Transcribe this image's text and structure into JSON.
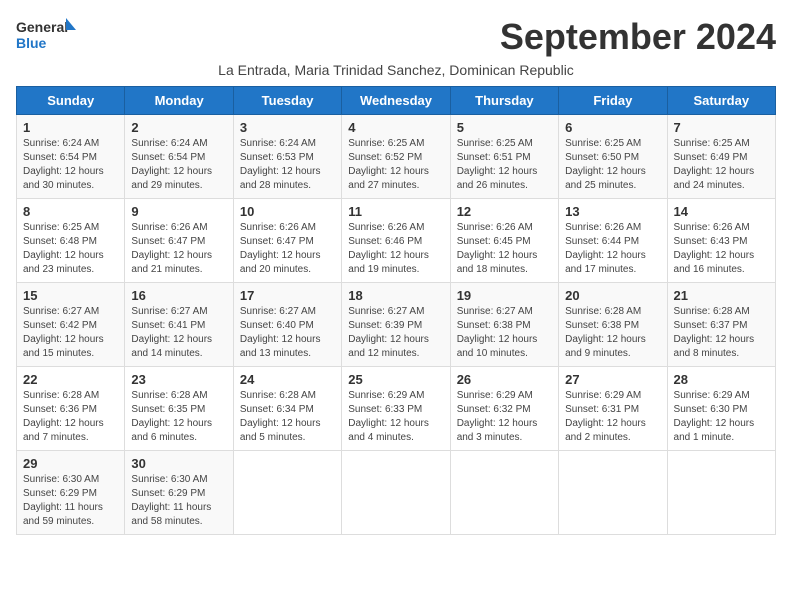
{
  "logo": {
    "line1": "General",
    "line2": "Blue"
  },
  "title": "September 2024",
  "subtitle": "La Entrada, Maria Trinidad Sanchez, Dominican Republic",
  "weekdays": [
    "Sunday",
    "Monday",
    "Tuesday",
    "Wednesday",
    "Thursday",
    "Friday",
    "Saturday"
  ],
  "weeks": [
    [
      {
        "day": "1",
        "rise": "6:24 AM",
        "set": "6:54 PM",
        "daylight": "12 hours and 30 minutes."
      },
      {
        "day": "2",
        "rise": "6:24 AM",
        "set": "6:54 PM",
        "daylight": "12 hours and 29 minutes."
      },
      {
        "day": "3",
        "rise": "6:24 AM",
        "set": "6:53 PM",
        "daylight": "12 hours and 28 minutes."
      },
      {
        "day": "4",
        "rise": "6:25 AM",
        "set": "6:52 PM",
        "daylight": "12 hours and 27 minutes."
      },
      {
        "day": "5",
        "rise": "6:25 AM",
        "set": "6:51 PM",
        "daylight": "12 hours and 26 minutes."
      },
      {
        "day": "6",
        "rise": "6:25 AM",
        "set": "6:50 PM",
        "daylight": "12 hours and 25 minutes."
      },
      {
        "day": "7",
        "rise": "6:25 AM",
        "set": "6:49 PM",
        "daylight": "12 hours and 24 minutes."
      }
    ],
    [
      {
        "day": "8",
        "rise": "6:25 AM",
        "set": "6:48 PM",
        "daylight": "12 hours and 23 minutes."
      },
      {
        "day": "9",
        "rise": "6:26 AM",
        "set": "6:47 PM",
        "daylight": "12 hours and 21 minutes."
      },
      {
        "day": "10",
        "rise": "6:26 AM",
        "set": "6:47 PM",
        "daylight": "12 hours and 20 minutes."
      },
      {
        "day": "11",
        "rise": "6:26 AM",
        "set": "6:46 PM",
        "daylight": "12 hours and 19 minutes."
      },
      {
        "day": "12",
        "rise": "6:26 AM",
        "set": "6:45 PM",
        "daylight": "12 hours and 18 minutes."
      },
      {
        "day": "13",
        "rise": "6:26 AM",
        "set": "6:44 PM",
        "daylight": "12 hours and 17 minutes."
      },
      {
        "day": "14",
        "rise": "6:26 AM",
        "set": "6:43 PM",
        "daylight": "12 hours and 16 minutes."
      }
    ],
    [
      {
        "day": "15",
        "rise": "6:27 AM",
        "set": "6:42 PM",
        "daylight": "12 hours and 15 minutes."
      },
      {
        "day": "16",
        "rise": "6:27 AM",
        "set": "6:41 PM",
        "daylight": "12 hours and 14 minutes."
      },
      {
        "day": "17",
        "rise": "6:27 AM",
        "set": "6:40 PM",
        "daylight": "12 hours and 13 minutes."
      },
      {
        "day": "18",
        "rise": "6:27 AM",
        "set": "6:39 PM",
        "daylight": "12 hours and 12 minutes."
      },
      {
        "day": "19",
        "rise": "6:27 AM",
        "set": "6:38 PM",
        "daylight": "12 hours and 10 minutes."
      },
      {
        "day": "20",
        "rise": "6:28 AM",
        "set": "6:38 PM",
        "daylight": "12 hours and 9 minutes."
      },
      {
        "day": "21",
        "rise": "6:28 AM",
        "set": "6:37 PM",
        "daylight": "12 hours and 8 minutes."
      }
    ],
    [
      {
        "day": "22",
        "rise": "6:28 AM",
        "set": "6:36 PM",
        "daylight": "12 hours and 7 minutes."
      },
      {
        "day": "23",
        "rise": "6:28 AM",
        "set": "6:35 PM",
        "daylight": "12 hours and 6 minutes."
      },
      {
        "day": "24",
        "rise": "6:28 AM",
        "set": "6:34 PM",
        "daylight": "12 hours and 5 minutes."
      },
      {
        "day": "25",
        "rise": "6:29 AM",
        "set": "6:33 PM",
        "daylight": "12 hours and 4 minutes."
      },
      {
        "day": "26",
        "rise": "6:29 AM",
        "set": "6:32 PM",
        "daylight": "12 hours and 3 minutes."
      },
      {
        "day": "27",
        "rise": "6:29 AM",
        "set": "6:31 PM",
        "daylight": "12 hours and 2 minutes."
      },
      {
        "day": "28",
        "rise": "6:29 AM",
        "set": "6:30 PM",
        "daylight": "12 hours and 1 minute."
      }
    ],
    [
      {
        "day": "29",
        "rise": "6:30 AM",
        "set": "6:29 PM",
        "daylight": "11 hours and 59 minutes."
      },
      {
        "day": "30",
        "rise": "6:30 AM",
        "set": "6:29 PM",
        "daylight": "11 hours and 58 minutes."
      },
      null,
      null,
      null,
      null,
      null
    ]
  ]
}
